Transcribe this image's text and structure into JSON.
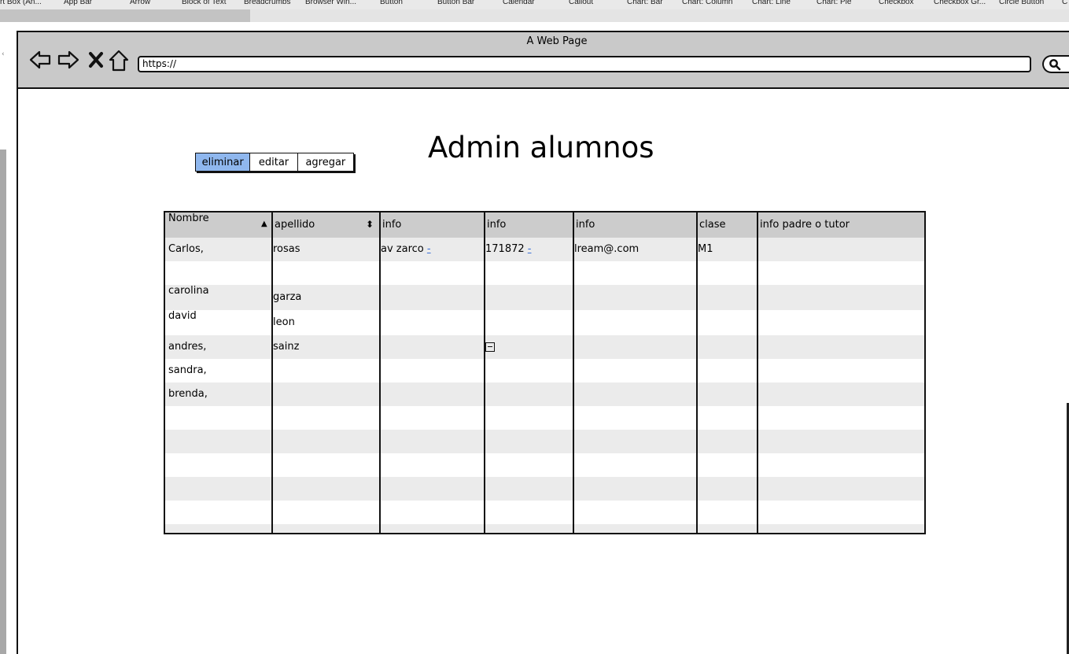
{
  "library": {
    "items": [
      "rt Box (An...",
      "App Bar",
      "Arrow",
      "Block of Text",
      "Breadcrumbs",
      "Browser Win...",
      "Button",
      "Button Bar",
      "Calendar",
      "Callout",
      "Chart: Bar",
      "Chart: Column",
      "Chart: Line",
      "Chart: Pie",
      "Checkbox",
      "Checkbox Gr...",
      "Circle Button",
      "C"
    ]
  },
  "browser": {
    "title": "A Web Page",
    "url": "https://"
  },
  "page": {
    "title": "Admin alumnos"
  },
  "button_bar": {
    "buttons": [
      {
        "label": "eliminar",
        "active": true
      },
      {
        "label": "editar",
        "active": false
      },
      {
        "label": "agregar",
        "active": false
      }
    ]
  },
  "table": {
    "headers": [
      "Nombre",
      "apellido",
      "info",
      "info",
      "info",
      "clase",
      "info padre o tutor"
    ],
    "rows": [
      [
        "Carlos,",
        "rosas",
        "av zarco",
        "171872",
        "lream@.com",
        "M1",
        ""
      ],
      [
        "",
        "",
        "",
        "",
        "",
        "",
        ""
      ],
      [
        "carolina",
        "garza",
        "",
        "",
        "",
        "",
        ""
      ],
      [
        "david",
        "leon",
        "",
        "",
        "",
        "",
        ""
      ],
      [
        "andres,",
        "sainz",
        "",
        "",
        "",
        "",
        ""
      ],
      [
        "sandra,",
        "",
        "",
        "",
        "",
        "",
        ""
      ],
      [
        "brenda,",
        "",
        "",
        "",
        "",
        "",
        ""
      ]
    ],
    "link_marks": {
      "r0c2": "-",
      "r0c3": "-"
    }
  }
}
